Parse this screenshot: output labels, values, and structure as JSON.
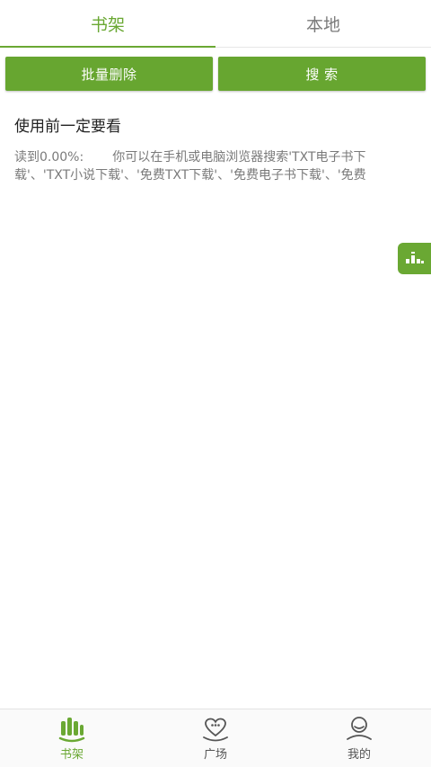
{
  "top_tabs": [
    {
      "label": "书架",
      "active": true
    },
    {
      "label": "本地",
      "active": false
    }
  ],
  "actions": {
    "batch_delete_label": "批量删除",
    "search_label": "搜 索"
  },
  "books": [
    {
      "title": "使用前一定要看",
      "progress": "读到0.00%:",
      "excerpt": "你可以在手机或电脑浏览器搜索'TXT电子书下载'、'TXT小说下载'、'免费TXT下载'、'免费电子书下载'、'免费"
    }
  ],
  "float_button": {
    "icon": "bar-chart-icon"
  },
  "bottom_nav": [
    {
      "label": "书架",
      "icon": "bookshelf-icon",
      "active": true
    },
    {
      "label": "广场",
      "icon": "heart-face-icon",
      "active": false
    },
    {
      "label": "我的",
      "icon": "user-icon",
      "active": false
    }
  ],
  "colors": {
    "accent": "#6aa833",
    "button": "#67a630",
    "text_primary": "#222222",
    "text_secondary": "#7a7a7a",
    "nav_inactive": "#555555"
  }
}
